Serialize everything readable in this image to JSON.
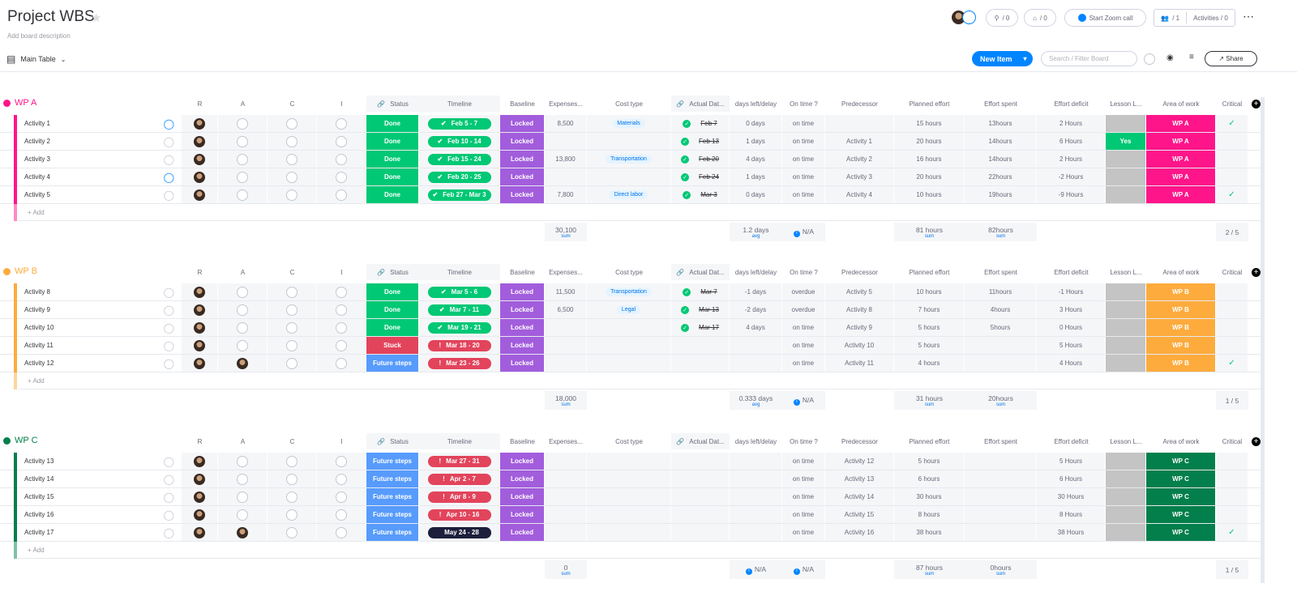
{
  "header": {
    "title": "Project WBS",
    "description": "Add board description",
    "view": "Main Table",
    "updates_count": "/ 0",
    "integrations_count": "/ 0",
    "zoom_label": "Start Zoom call",
    "members_count": "/ 1",
    "activities_label": "Activities / 0",
    "new_item": "New Item",
    "search_placeholder": "Search / Filter Board",
    "share": "Share"
  },
  "columns": [
    "R",
    "A",
    "C",
    "I",
    "Status",
    "Timeline",
    "Baseline",
    "Expenses...",
    "Cost type",
    "Actual Dat...",
    "days left/delay",
    "On time ?",
    "Predecessor",
    "Planned effort",
    "Effort spent",
    "Effort deficit",
    "Lesson L...",
    "Area of work",
    "Critical"
  ],
  "add_label": "+ Add",
  "colors": {
    "Done": "#00c875",
    "Stuck": "#e2445c",
    "Future steps": "#579bfc",
    "Locked": "#a25ddc",
    "green": "#00c875",
    "red": "#e2445c",
    "dark": "#1c1f3b",
    "Yes": "#00c875"
  },
  "groups": [
    {
      "name": "WP A",
      "color": "#ff158a",
      "rows": [
        {
          "name": "Activity 1",
          "updates": true,
          "R": true,
          "A": false,
          "status": "Done",
          "timeline": "Feb 5 - 7",
          "tl": "green",
          "baseline": "Locked",
          "expenses": "8,500",
          "cost": "Materials",
          "actual": "Feb 7",
          "days": "0 days",
          "ontime": "on time",
          "pred": "",
          "planned": "15 hours",
          "spent": "13hours",
          "deficit": "2 Hours",
          "lesson": "",
          "area": "WP A",
          "critical": true
        },
        {
          "name": "Activity 2",
          "updates": false,
          "R": true,
          "A": false,
          "status": "Done",
          "timeline": "Feb 10 - 14",
          "tl": "green",
          "baseline": "Locked",
          "expenses": "",
          "cost": "",
          "actual": "Feb 13",
          "days": "1 days",
          "ontime": "on time",
          "pred": "Activity 1",
          "planned": "20 hours",
          "spent": "14hours",
          "deficit": "6 Hours",
          "lesson": "Yes",
          "area": "WP A",
          "critical": false
        },
        {
          "name": "Activity 3",
          "updates": false,
          "R": true,
          "A": false,
          "status": "Done",
          "timeline": "Feb 15 - 24",
          "tl": "green",
          "baseline": "Locked",
          "expenses": "13,800",
          "cost": "Transportation",
          "actual": "Feb 20",
          "days": "4 days",
          "ontime": "on time",
          "pred": "Activity 2",
          "planned": "16 hours",
          "spent": "14hours",
          "deficit": "2 Hours",
          "lesson": "",
          "area": "WP A",
          "critical": false
        },
        {
          "name": "Activity 4",
          "updates": true,
          "R": true,
          "A": false,
          "status": "Done",
          "timeline": "Feb 20 - 25",
          "tl": "green",
          "baseline": "Locked",
          "expenses": "",
          "cost": "",
          "actual": "Feb 24",
          "days": "1 days",
          "ontime": "on time",
          "pred": "Activity 3",
          "planned": "20 hours",
          "spent": "22hours",
          "deficit": "-2 Hours",
          "lesson": "",
          "area": "WP A",
          "critical": false
        },
        {
          "name": "Activity 5",
          "updates": false,
          "R": true,
          "A": false,
          "status": "Done",
          "timeline": "Feb 27 - Mar 3",
          "tl": "green",
          "baseline": "Locked",
          "expenses": "7,800",
          "cost": "Direct labor",
          "actual": "Mar 3",
          "days": "0 days",
          "ontime": "on time",
          "pred": "Activity 4",
          "planned": "10 hours",
          "spent": "19hours",
          "deficit": "-9 Hours",
          "lesson": "",
          "area": "WP A",
          "critical": true
        }
      ],
      "summary": {
        "expenses": "30,100",
        "expenses_fn": "sum",
        "days": "1.2 days",
        "days_fn": "avg",
        "ontime": "N/A",
        "planned": "81 hours",
        "planned_fn": "sum",
        "spent": "82hours",
        "spent_fn": "sum",
        "critical": "2 / 5"
      }
    },
    {
      "name": "WP B",
      "color": "#fdab3d",
      "rows": [
        {
          "name": "Activity 8",
          "updates": false,
          "R": true,
          "A": false,
          "status": "Done",
          "timeline": "Mar 5 - 6",
          "tl": "green",
          "baseline": "Locked",
          "expenses": "11,500",
          "cost": "Transportation",
          "actual": "Mar 7",
          "days": "-1 days",
          "ontime": "overdue",
          "pred": "Activity 5",
          "planned": "10 hours",
          "spent": "11hours",
          "deficit": "-1 Hours",
          "lesson": "",
          "area": "WP B",
          "critical": false
        },
        {
          "name": "Activity 9",
          "updates": false,
          "R": true,
          "A": false,
          "status": "Done",
          "timeline": "Mar 7 - 11",
          "tl": "green",
          "baseline": "Locked",
          "expenses": "6,500",
          "cost": "Legal",
          "actual": "Mar 13",
          "days": "-2 days",
          "ontime": "overdue",
          "pred": "Activity 8",
          "planned": "7 hours",
          "spent": "4hours",
          "deficit": "3 Hours",
          "lesson": "",
          "area": "WP B",
          "critical": false
        },
        {
          "name": "Activity 10",
          "updates": false,
          "R": true,
          "A": false,
          "status": "Done",
          "timeline": "Mar 19 - 21",
          "tl": "green",
          "baseline": "Locked",
          "expenses": "",
          "cost": "",
          "actual": "Mar 17",
          "days": "4 days",
          "ontime": "on time",
          "pred": "Activity 9",
          "planned": "5 hours",
          "spent": "5hours",
          "deficit": "0 Hours",
          "lesson": "",
          "area": "WP B",
          "critical": false
        },
        {
          "name": "Activity 11",
          "updates": false,
          "R": true,
          "A": false,
          "status": "Stuck",
          "timeline": "Mar 18 - 20",
          "tl": "red",
          "baseline": "Locked",
          "expenses": "",
          "cost": "",
          "actual": "",
          "days": "",
          "ontime": "on time",
          "pred": "Activity 10",
          "planned": "5 hours",
          "spent": "",
          "deficit": "5 Hours",
          "lesson": "",
          "area": "WP B",
          "critical": false
        },
        {
          "name": "Activity 12",
          "updates": false,
          "R": true,
          "A": true,
          "status": "Future steps",
          "timeline": "Mar 23 - 26",
          "tl": "red",
          "baseline": "Locked",
          "expenses": "",
          "cost": "",
          "actual": "",
          "days": "",
          "ontime": "on time",
          "pred": "Activity 11",
          "planned": "4 hours",
          "spent": "",
          "deficit": "4 Hours",
          "lesson": "",
          "area": "WP B",
          "critical": true
        }
      ],
      "summary": {
        "expenses": "18,000",
        "expenses_fn": "sum",
        "days": "0.333 days",
        "days_fn": "avg",
        "ontime": "N/A",
        "planned": "31 hours",
        "planned_fn": "sum",
        "spent": "20hours",
        "spent_fn": "sum",
        "critical": "1 / 5"
      }
    },
    {
      "name": "WP C",
      "color": "#037f4c",
      "rows": [
        {
          "name": "Activity 13",
          "updates": false,
          "R": true,
          "A": false,
          "status": "Future steps",
          "timeline": "Mar 27 - 31",
          "tl": "red",
          "baseline": "Locked",
          "expenses": "",
          "cost": "",
          "actual": "",
          "days": "",
          "ontime": "on time",
          "pred": "Activity 12",
          "planned": "5 hours",
          "spent": "",
          "deficit": "5 Hours",
          "lesson": "",
          "area": "WP C",
          "critical": false
        },
        {
          "name": "Activity 14",
          "updates": false,
          "R": true,
          "A": false,
          "status": "Future steps",
          "timeline": "Apr 2 - 7",
          "tl": "red",
          "baseline": "Locked",
          "expenses": "",
          "cost": "",
          "actual": "",
          "days": "",
          "ontime": "on time",
          "pred": "Activity 13",
          "planned": "6 hours",
          "spent": "",
          "deficit": "6 Hours",
          "lesson": "",
          "area": "WP C",
          "critical": false
        },
        {
          "name": "Activity 15",
          "updates": false,
          "R": true,
          "A": false,
          "status": "Future steps",
          "timeline": "Apr 8 - 9",
          "tl": "red",
          "baseline": "Locked",
          "expenses": "",
          "cost": "",
          "actual": "",
          "days": "",
          "ontime": "on time",
          "pred": "Activity 14",
          "planned": "30 hours",
          "spent": "",
          "deficit": "30 Hours",
          "lesson": "",
          "area": "WP C",
          "critical": false
        },
        {
          "name": "Activity 16",
          "updates": false,
          "R": true,
          "A": false,
          "status": "Future steps",
          "timeline": "Apr 10 - 16",
          "tl": "red",
          "baseline": "Locked",
          "expenses": "",
          "cost": "",
          "actual": "",
          "days": "",
          "ontime": "on time",
          "pred": "Activity 15",
          "planned": "8 hours",
          "spent": "",
          "deficit": "8 Hours",
          "lesson": "",
          "area": "WP C",
          "critical": false
        },
        {
          "name": "Activity 17",
          "updates": false,
          "R": true,
          "A": true,
          "status": "Future steps",
          "timeline": "May 24 - 28",
          "tl": "dark",
          "baseline": "Locked",
          "expenses": "",
          "cost": "",
          "actual": "",
          "days": "",
          "ontime": "on time",
          "pred": "Activity 16",
          "planned": "38 hours",
          "spent": "",
          "deficit": "38 Hours",
          "lesson": "",
          "area": "WP C",
          "critical": true
        }
      ],
      "summary": {
        "expenses": "0",
        "expenses_fn": "sum",
        "days": "N/A",
        "days_fn": "",
        "ontime": "N/A",
        "planned": "87 hours",
        "planned_fn": "sum",
        "spent": "0hours",
        "spent_fn": "sum",
        "critical": "1 / 5"
      }
    }
  ]
}
